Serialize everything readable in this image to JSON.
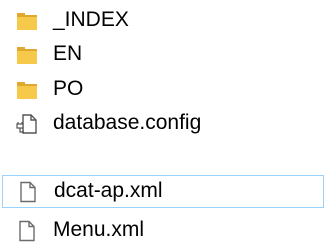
{
  "files": [
    {
      "name": "_INDEX",
      "icon": "folder-icon"
    },
    {
      "name": "EN",
      "icon": "folder-icon"
    },
    {
      "name": "PO",
      "icon": "folder-icon"
    },
    {
      "name": "database.config",
      "icon": "config-file-icon"
    },
    {
      "name": "dcat-ap.xml",
      "icon": "document-icon",
      "selected": true
    },
    {
      "name": "Menu.xml",
      "icon": "document-icon"
    }
  ],
  "colors": {
    "folder": "#f7c94b",
    "folder_dark": "#e0a82e",
    "selection_border": "#99d1ff"
  }
}
